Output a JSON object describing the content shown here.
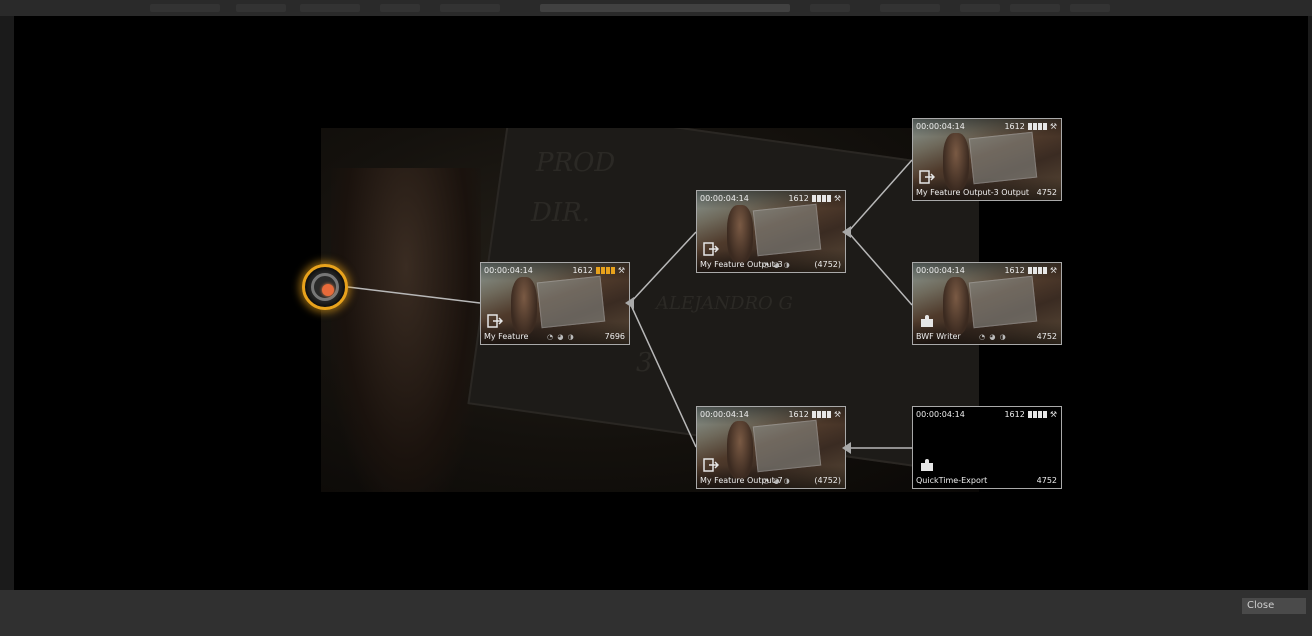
{
  "dialog": {
    "close_label": "Close"
  },
  "source": {
    "icon": "source-reel-icon",
    "accent": "#e8a21c"
  },
  "nodes": {
    "my_feature": {
      "timecode": "00:00:04:14",
      "frames": "1612",
      "name": "My Feature",
      "count": "7696",
      "icon": "export-icon",
      "status_color": "#e8a21c"
    },
    "output3": {
      "timecode": "00:00:04:14",
      "frames": "1612",
      "name": "My Feature Output-3",
      "count": "(4752)",
      "icon": "export-icon"
    },
    "output7": {
      "timecode": "00:00:04:14",
      "frames": "1612",
      "name": "My Feature Output-7",
      "count": "(4752)",
      "icon": "export-icon"
    },
    "output3_output": {
      "timecode": "00:00:04:14",
      "frames": "1612",
      "name": "My Feature Output-3 Output",
      "count": "4752",
      "icon": "export-icon"
    },
    "bwf_writer": {
      "timecode": "00:00:04:14",
      "frames": "1612",
      "name": "BWF Writer",
      "count": "4752",
      "icon": "plugin-icon"
    },
    "quicktime_export": {
      "timecode": "00:00:04:14",
      "frames": "1612",
      "name": "QuickTime-Export",
      "count": "4752",
      "icon": "plugin-icon"
    }
  },
  "background_still": {
    "chalk_text": [
      "PROD",
      "DIR.",
      "ALEJANDRO G",
      "3"
    ]
  }
}
